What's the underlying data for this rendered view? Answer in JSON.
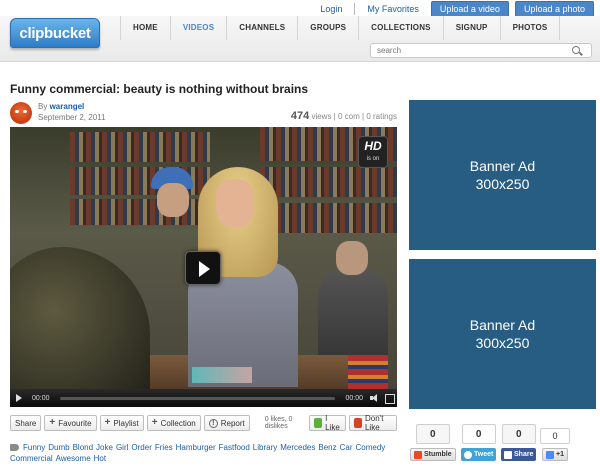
{
  "toplinks": {
    "login": "Login",
    "favorites": "My Favorites",
    "upload_video": "Upload a video",
    "upload_photo": "Upload a photo"
  },
  "logo": "clipbucket",
  "nav": [
    "HOME",
    "VIDEOS",
    "CHANNELS",
    "GROUPS",
    "COLLECTIONS",
    "SIGNUP",
    "PHOTOS"
  ],
  "nav_active": "VIDEOS",
  "search": {
    "placeholder": "search"
  },
  "video": {
    "title": "Funny commercial: beauty is nothing without brains",
    "by_label": "By",
    "author": "warangel",
    "date": "September 2, 2011",
    "views": "474",
    "views_label": "views",
    "comments": "0 com",
    "ratings": "0 ratings",
    "hd_label": "HD",
    "hd_sub": "is on",
    "time_current": "00:00",
    "time_total": "00:00"
  },
  "actions": {
    "share": "Share",
    "favourite": "Favourite",
    "playlist": "Playlist",
    "collection": "Collection",
    "report": "Report",
    "likes_text": "0 likes, 0 dislikes",
    "like": "I Like",
    "dislike": "Don't Like"
  },
  "tags": [
    "Funny",
    "Dumb",
    "Blond",
    "Joke",
    "Girl",
    "Order",
    "Fries",
    "Hamburger",
    "Fastfood",
    "Library",
    "Mercedes",
    "Benz",
    "Car",
    "Comedy",
    "Commercial",
    "Awesome",
    "Hot"
  ],
  "banners": [
    {
      "line1": "Banner Ad",
      "line2": "300x250"
    },
    {
      "line1": "Banner Ad",
      "line2": "300x250"
    }
  ],
  "social": {
    "stumble_count": "0",
    "stumble_label": "Stumble",
    "tweet_count": "0",
    "tweet_label": "Tweet",
    "share_count": "0",
    "share_label": "Share",
    "plus_count": "0",
    "plus_label": "+1"
  },
  "colors": {
    "accent": "#4b86c8",
    "banner": "#275d82",
    "link": "#1a5fa8"
  }
}
